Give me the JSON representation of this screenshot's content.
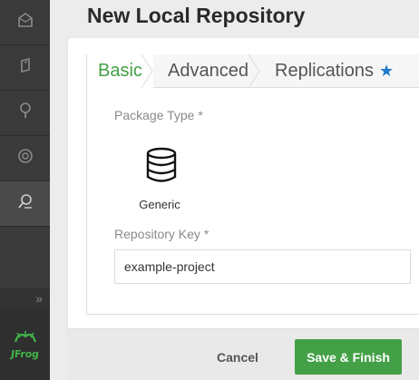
{
  "header": {
    "title": "New Local Repository"
  },
  "sidebar": {
    "items": [
      {
        "icon": "home-icon"
      },
      {
        "icon": "artifacts-icon"
      },
      {
        "icon": "search-icon"
      },
      {
        "icon": "builds-icon"
      },
      {
        "icon": "admin-icon"
      }
    ],
    "expand_label": "»",
    "logo_text": "JFrog"
  },
  "tabs": [
    {
      "label": "Basic",
      "active": true
    },
    {
      "label": "Advanced",
      "active": false
    },
    {
      "label": "Replications",
      "active": false,
      "badge": "★"
    }
  ],
  "form": {
    "package_type_label": "Package Type *",
    "package_type_value": "Generic",
    "repository_key_label": "Repository Key *",
    "repository_key_value": "example-project"
  },
  "footer": {
    "cancel_label": "Cancel",
    "save_label": "Save & Finish"
  },
  "colors": {
    "accent": "#43a047",
    "star": "#1c78c9",
    "sidebar": "#3a3a3a"
  }
}
